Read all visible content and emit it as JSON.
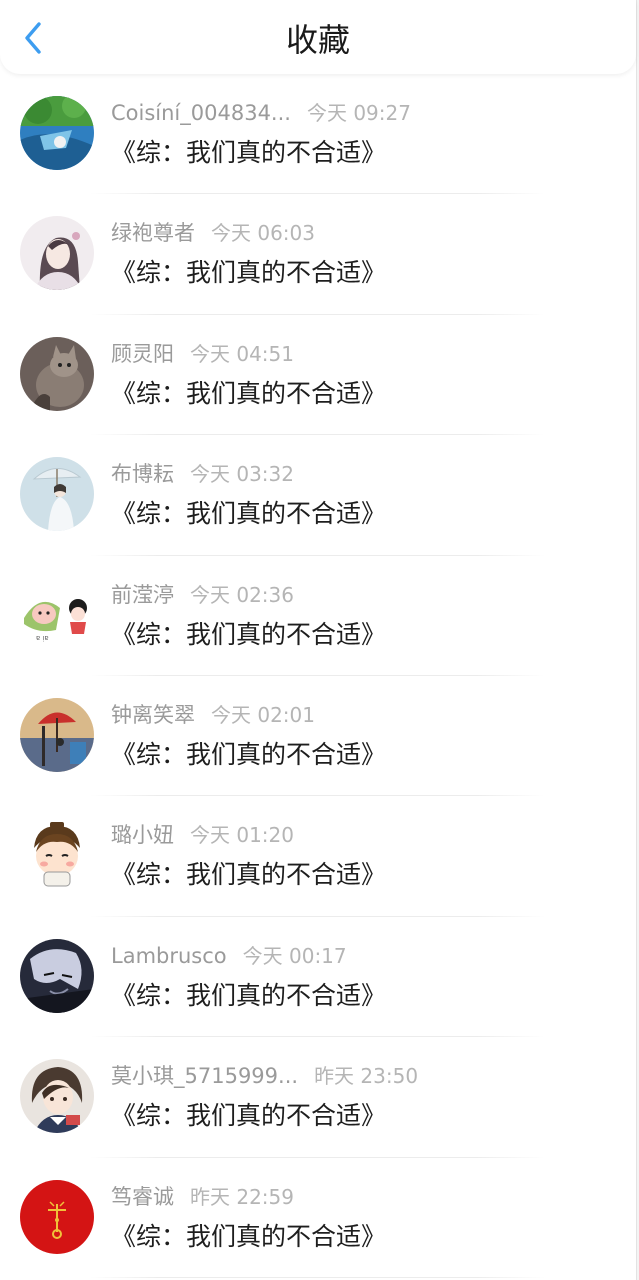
{
  "header": {
    "title": "收藏",
    "back_icon": "chevron-left-icon",
    "accent_color": "#3d9df0"
  },
  "items": [
    {
      "name": "Coisíní_004834...",
      "time": "今天 09:27",
      "book": "《综：我们真的不合适》",
      "avatar": "landscape-avatar"
    },
    {
      "name": "绿袍尊者",
      "time": "今天 06:03",
      "book": "《综：我们真的不合适》",
      "avatar": "ink-portrait-avatar"
    },
    {
      "name": "顾灵阳",
      "time": "今天 04:51",
      "book": "《综：我们真的不合适》",
      "avatar": "cat-avatar"
    },
    {
      "name": "布博耘",
      "time": "今天 03:32",
      "book": "《综：我们真的不合适》",
      "avatar": "umbrella-girl-avatar"
    },
    {
      "name": "前滢渟",
      "time": "今天 02:36",
      "book": "《综：我们真的不合适》",
      "avatar": "cartoon-zongzi-avatar"
    },
    {
      "name": "钟离笑翠",
      "time": "今天 02:01",
      "book": "《综：我们真的不合适》",
      "avatar": "red-umbrella-avatar"
    },
    {
      "name": "璐小妞",
      "time": "今天 01:20",
      "book": "《综：我们真的不合适》",
      "avatar": "cartoon-boy-avatar"
    },
    {
      "name": "Lambrusco",
      "time": "今天 00:17",
      "book": "《综：我们真的不合适》",
      "avatar": "anime-dark-avatar"
    },
    {
      "name": "莫小琪_5715999...",
      "time": "昨天 23:50",
      "book": "《综：我们真的不合适》",
      "avatar": "anime-girl-avatar"
    },
    {
      "name": "笃睿诚",
      "time": "昨天 22:59",
      "book": "《综：我们真的不合适》",
      "avatar": "red-seal-avatar"
    }
  ]
}
